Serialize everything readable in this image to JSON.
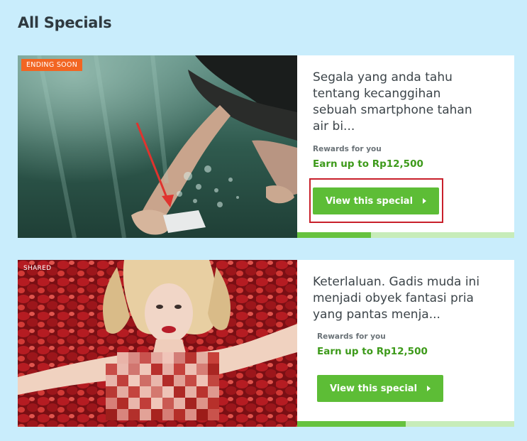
{
  "page": {
    "title": "All Specials"
  },
  "specials": [
    {
      "tag": "ENDING SOON",
      "headline": "Segala yang anda tahu tentang kecanggihan sebuah smartphone tahan air bi...",
      "rewards_label": "Rewards for you",
      "rewards_value": "Earn up to Rp12,500",
      "button_label": "View this special",
      "progress": 0.34,
      "image": "underwater-swimmer-with-smartphone-photo"
    },
    {
      "tag": "SHARED",
      "headline": "Keterlaluan. Gadis muda ini menjadi obyek fantasi pria yang pantas menja...",
      "rewards_label": "Rewards for you",
      "rewards_value": "Earn up to Rp12,500",
      "button_label": "View this special",
      "progress": 0.5,
      "image": "woman-on-rose-petals-pixelated-photo"
    }
  ],
  "colors": {
    "background": "#c9edfc",
    "button": "#5dbd36",
    "reward_text": "#3d9a1a",
    "tag_ending": "#f26522",
    "highlight": "#c8202b",
    "progress_fill": "#66c23f",
    "progress_track": "#c7ecb9"
  },
  "icons": {
    "button_arrow": "caret-right-icon"
  }
}
